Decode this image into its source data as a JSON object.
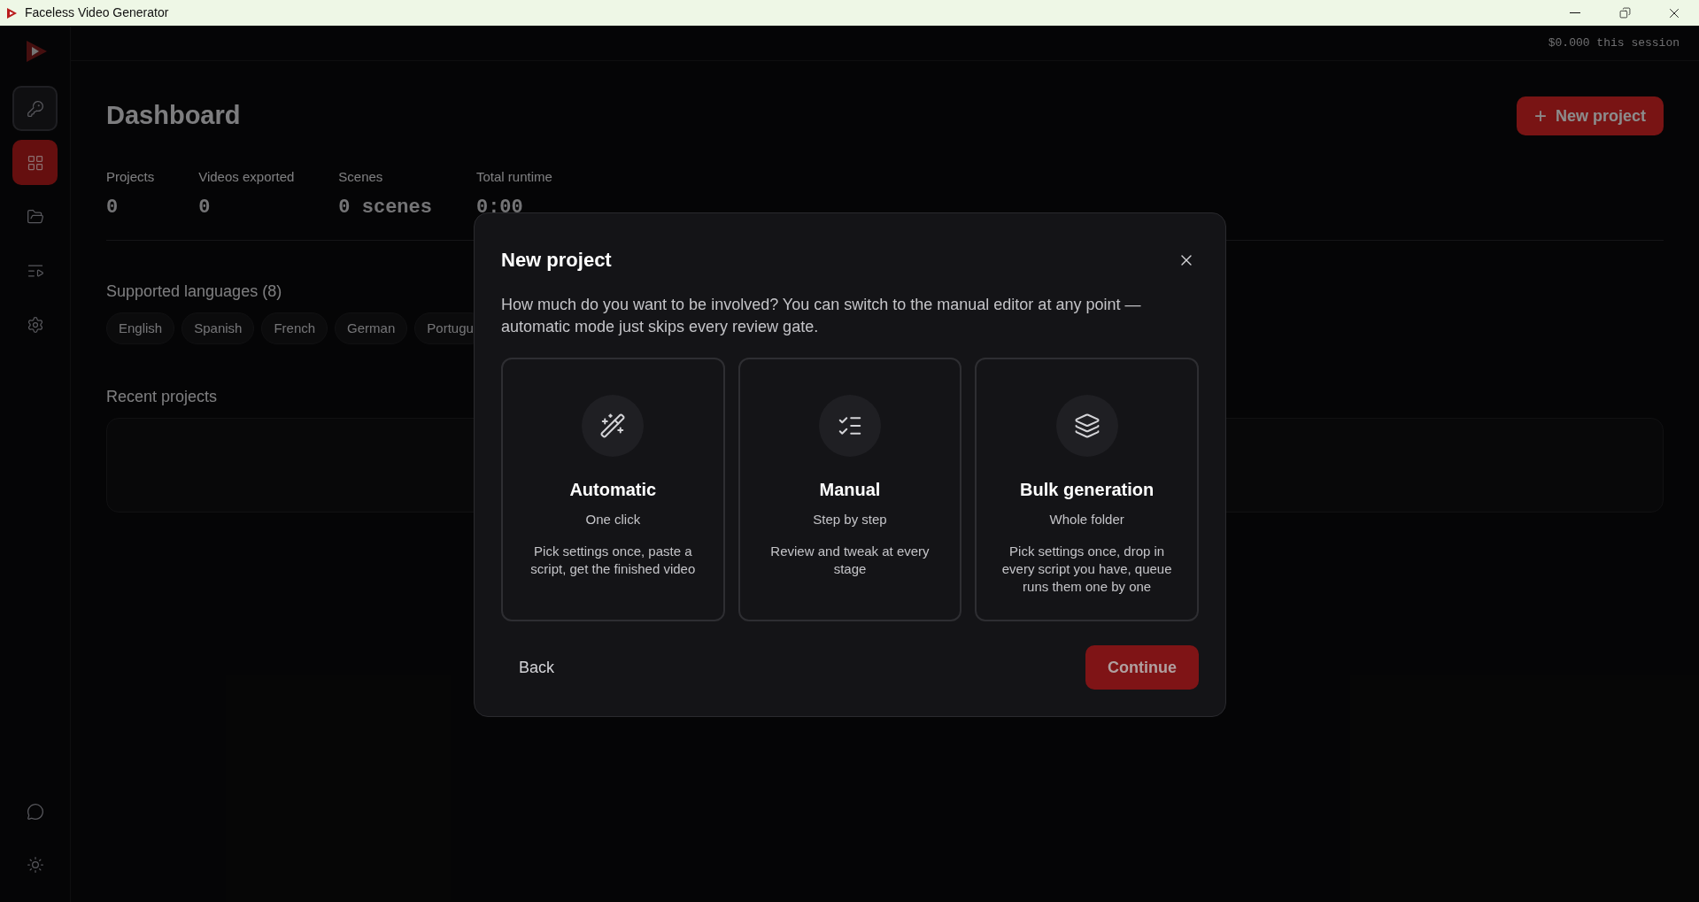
{
  "window": {
    "title": "Faceless Video Generator"
  },
  "session_cost": "$0.000 this session",
  "sidebar": {
    "items": [
      {
        "kind": "key",
        "selected": false,
        "boxed": true
      },
      {
        "kind": "dashboard",
        "selected": true,
        "boxed": false
      },
      {
        "kind": "folder",
        "selected": false,
        "boxed": false
      },
      {
        "kind": "queue",
        "selected": false,
        "boxed": false
      },
      {
        "kind": "settings",
        "selected": false,
        "boxed": false
      }
    ],
    "bottom": [
      {
        "kind": "chat"
      },
      {
        "kind": "theme"
      }
    ]
  },
  "dashboard": {
    "title": "Dashboard",
    "new_button": {
      "icon": "+",
      "label": "New project"
    },
    "stats": [
      {
        "label": "Projects",
        "value": "0"
      },
      {
        "label": "Videos exported",
        "value": "0"
      },
      {
        "label": "Scenes",
        "value": "0 scenes"
      },
      {
        "label": "Total runtime",
        "value": "0:00"
      }
    ],
    "languages": {
      "heading": "Supported languages (8)",
      "items": [
        "English",
        "Spanish",
        "French",
        "German",
        "Portugu"
      ]
    },
    "recent": {
      "heading": "Recent projects"
    }
  },
  "dialog": {
    "title": "New project",
    "description": "How much do you want to be involved? You can switch to the manual editor at any point — automatic mode just skips every review gate.",
    "options": [
      {
        "kind": "wand",
        "title": "Automatic",
        "subtitle": "One click",
        "text": "Pick settings once, paste a script, get the finished video",
        "selected": false
      },
      {
        "kind": "checklist",
        "title": "Manual",
        "subtitle": "Step by step",
        "text": "Review and tweak at every stage",
        "selected": false
      },
      {
        "kind": "layers",
        "title": "Bulk generation",
        "subtitle": "Whole folder",
        "text": "Pick settings once, drop in every script you have, queue runs them one by one",
        "selected": false
      }
    ],
    "back": "Back",
    "continue": {
      "label": "Continue",
      "disabled": true
    }
  }
}
